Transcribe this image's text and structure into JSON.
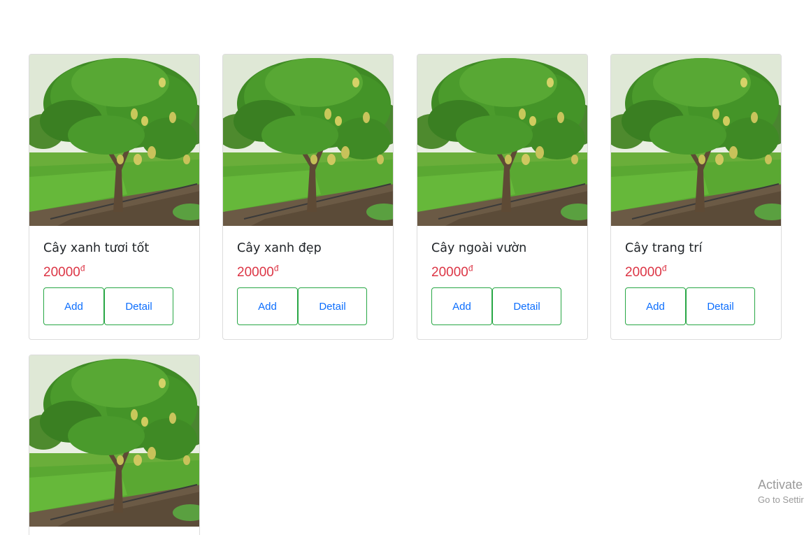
{
  "products": [
    {
      "name": "Cây xanh tươi tốt",
      "price": "20000",
      "currency": "đ",
      "add_label": "Add",
      "detail_label": "Detail"
    },
    {
      "name": "Cây xanh đẹp",
      "price": "20000",
      "currency": "đ",
      "add_label": "Add",
      "detail_label": "Detail"
    },
    {
      "name": "Cây ngoài vườn",
      "price": "20000",
      "currency": "đ",
      "add_label": "Add",
      "detail_label": "Detail"
    },
    {
      "name": "Cây trang trí",
      "price": "20000",
      "currency": "đ",
      "add_label": "Add",
      "detail_label": "Detail"
    },
    {
      "name": "",
      "price": "",
      "currency": "",
      "add_label": "",
      "detail_label": ""
    }
  ],
  "watermark": {
    "line1": "Activate",
    "line2": "Go to Settir"
  }
}
